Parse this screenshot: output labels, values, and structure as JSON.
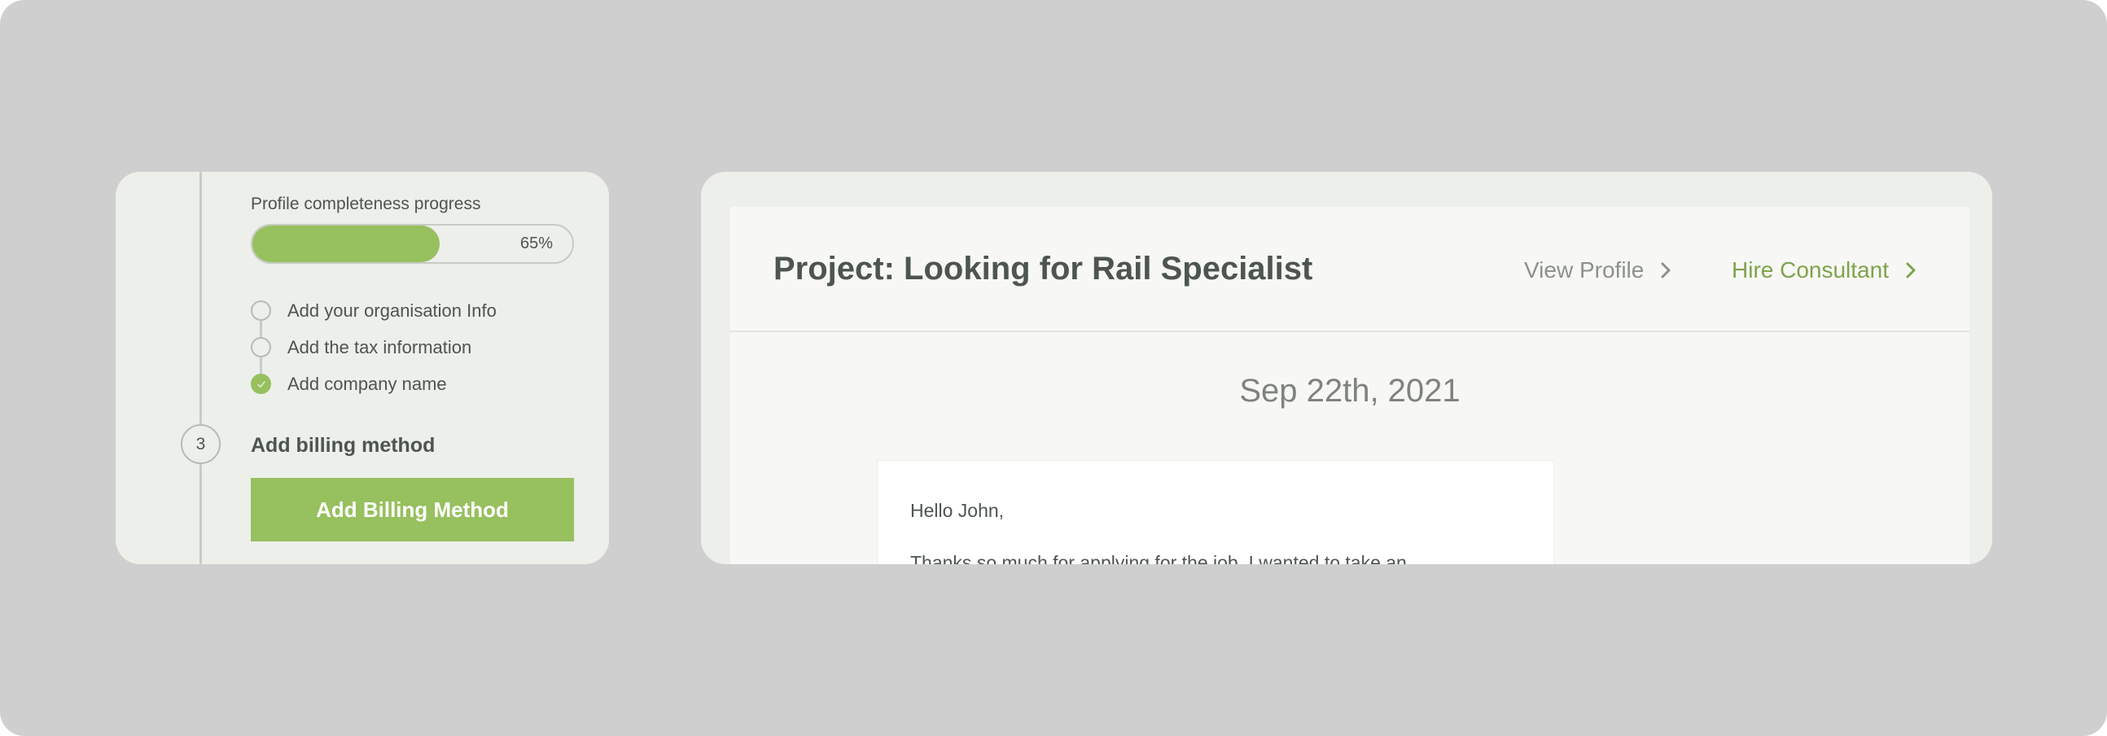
{
  "onboarding": {
    "progress_title": "Profile completeness progress",
    "progress_value": 65,
    "progress_text": "65%",
    "checklist": [
      {
        "label": "Add your organisation Info",
        "done": false
      },
      {
        "label": "Add the tax information",
        "done": false
      },
      {
        "label": "Add company name",
        "done": true
      }
    ],
    "step_number": "3",
    "step_title": "Add billing method",
    "billing_button_label": "Add Billing Method"
  },
  "project": {
    "title": "Project: Looking for Rail Specialist",
    "view_profile_label": "View Profile",
    "hire_label": "Hire Consultant",
    "date": "Sep 22th, 2021",
    "message": {
      "greeting": "Hello John,",
      "body": "Thanks so much for applying for the job. I wanted to take an"
    }
  },
  "colors": {
    "accent_green": "#97c05e",
    "link_green": "#7ea34a",
    "text_dark": "#4d554f",
    "card_bg": "#edefea"
  },
  "icons": {
    "check": "check-icon",
    "chevron": "chevron-right-icon"
  }
}
